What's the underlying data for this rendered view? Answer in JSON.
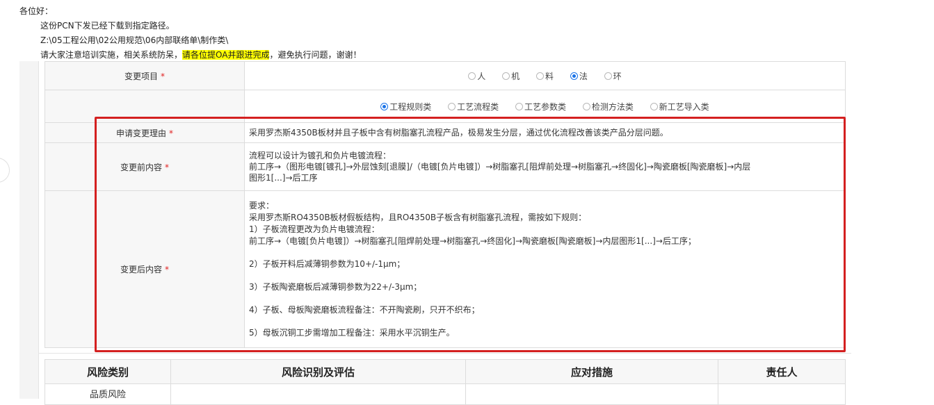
{
  "mail": {
    "greeting": "各位好：",
    "line1": "这份PCN下发已经下载到指定路径。",
    "line2": "Z:\\05工程公用\\02公用规范\\06内部联络单\\制作类\\",
    "line3_pre": "请大家注意培训实施，相关系统防呆，",
    "line3_highlight": "请各位提OA并跟进完成",
    "line3_post": "，避免执行问题，谢谢！"
  },
  "form": {
    "change_item": {
      "label": "变更项目",
      "required_mark": "*",
      "options": [
        "人",
        "机",
        "料",
        "法",
        "环"
      ],
      "selected": "法"
    },
    "change_category": {
      "options": [
        "工程规则类",
        "工艺流程类",
        "工艺参数类",
        "检测方法类",
        "新工艺导入类"
      ],
      "selected": "工程规则类"
    },
    "reason": {
      "label": "申请变更理由",
      "required_mark": "*",
      "value": "采用罗杰斯4350B板材并且子板中含有树脂塞孔流程产品，极易发生分层，通过优化流程改善该类产品分层问题。"
    },
    "before": {
      "label": "变更前内容",
      "required_mark": "*",
      "lines": [
        "流程可以设计为镀孔和负片电镀流程：",
        "前工序→（图形电镀[镀孔]→外层蚀刻[退膜]/（电镀[负片电镀]）→树脂塞孔[阻焊前处理→树脂塞孔→终固化]→陶瓷磨板[陶瓷磨板]→内层",
        "图形1[...]→后工序"
      ]
    },
    "after": {
      "label": "变更后内容",
      "required_mark": "*",
      "lines": [
        "要求：",
        "采用罗杰斯RO4350B板材假板结构，且RO4350B子板含有树脂塞孔流程，需按如下规则：",
        "1）子板流程更改为负片电镀流程：",
        "前工序→（电镀[负片电镀]）→树脂塞孔[阻焊前处理→树脂塞孔→终固化]→陶瓷磨板[陶瓷磨板]→内层图形1[...]→后工序；",
        "",
        "2）子板开料后减薄铜参数为10+/-1μm；",
        "",
        "3）子板陶瓷磨板后减薄铜参数为22+/-3μm；",
        "",
        "4）子板、母板陶瓷磨板流程备注：不开陶瓷刷，只开不织布；",
        "",
        "5）母板沉铜工步需增加工程备注：采用水平沉铜生产。"
      ]
    }
  },
  "risk_table": {
    "headers": [
      "风险类别",
      "风险识别及评估",
      "应对措施",
      "责任人"
    ],
    "first_row_category": "品质风险"
  },
  "colors": {
    "highlight": "#ffff00",
    "required": "#e02020",
    "annotation_box": "#d42020",
    "radio_selected": "#1a73e8"
  }
}
